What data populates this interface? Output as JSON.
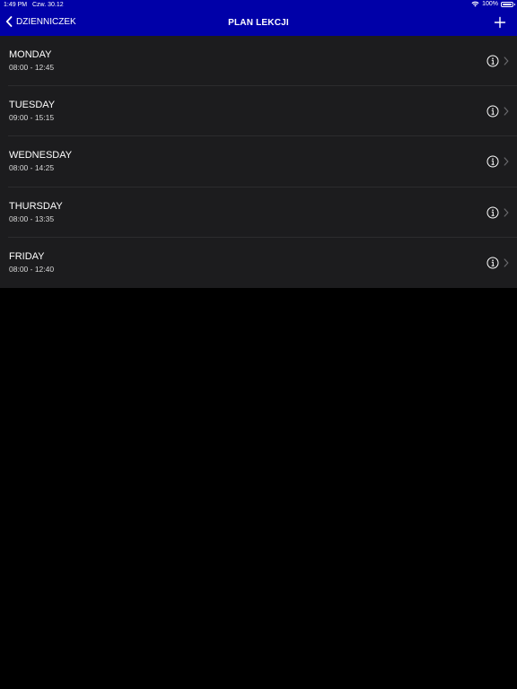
{
  "status_bar": {
    "time": "1:49 PM",
    "date": "Czw. 30.12",
    "battery": "100%",
    "battery_level": 1.0
  },
  "nav": {
    "back_label": "DZIENNICZEK",
    "title": "PLAN LEKCJI",
    "add_icon": "plus-icon"
  },
  "colors": {
    "nav_bg": "#0000a8",
    "page_bg": "#000000",
    "row_bg": "#1c1c1e",
    "separator": "#2c2c2e"
  },
  "days": [
    {
      "day": "MONDAY",
      "hours": "08:00 - 12:45"
    },
    {
      "day": "TUESDAY",
      "hours": "09:00 - 15:15"
    },
    {
      "day": "WEDNESDAY",
      "hours": "08:00 - 14:25"
    },
    {
      "day": "THURSDAY",
      "hours": "08:00 - 13:35"
    },
    {
      "day": "FRIDAY",
      "hours": "08:00 - 12:40"
    }
  ]
}
